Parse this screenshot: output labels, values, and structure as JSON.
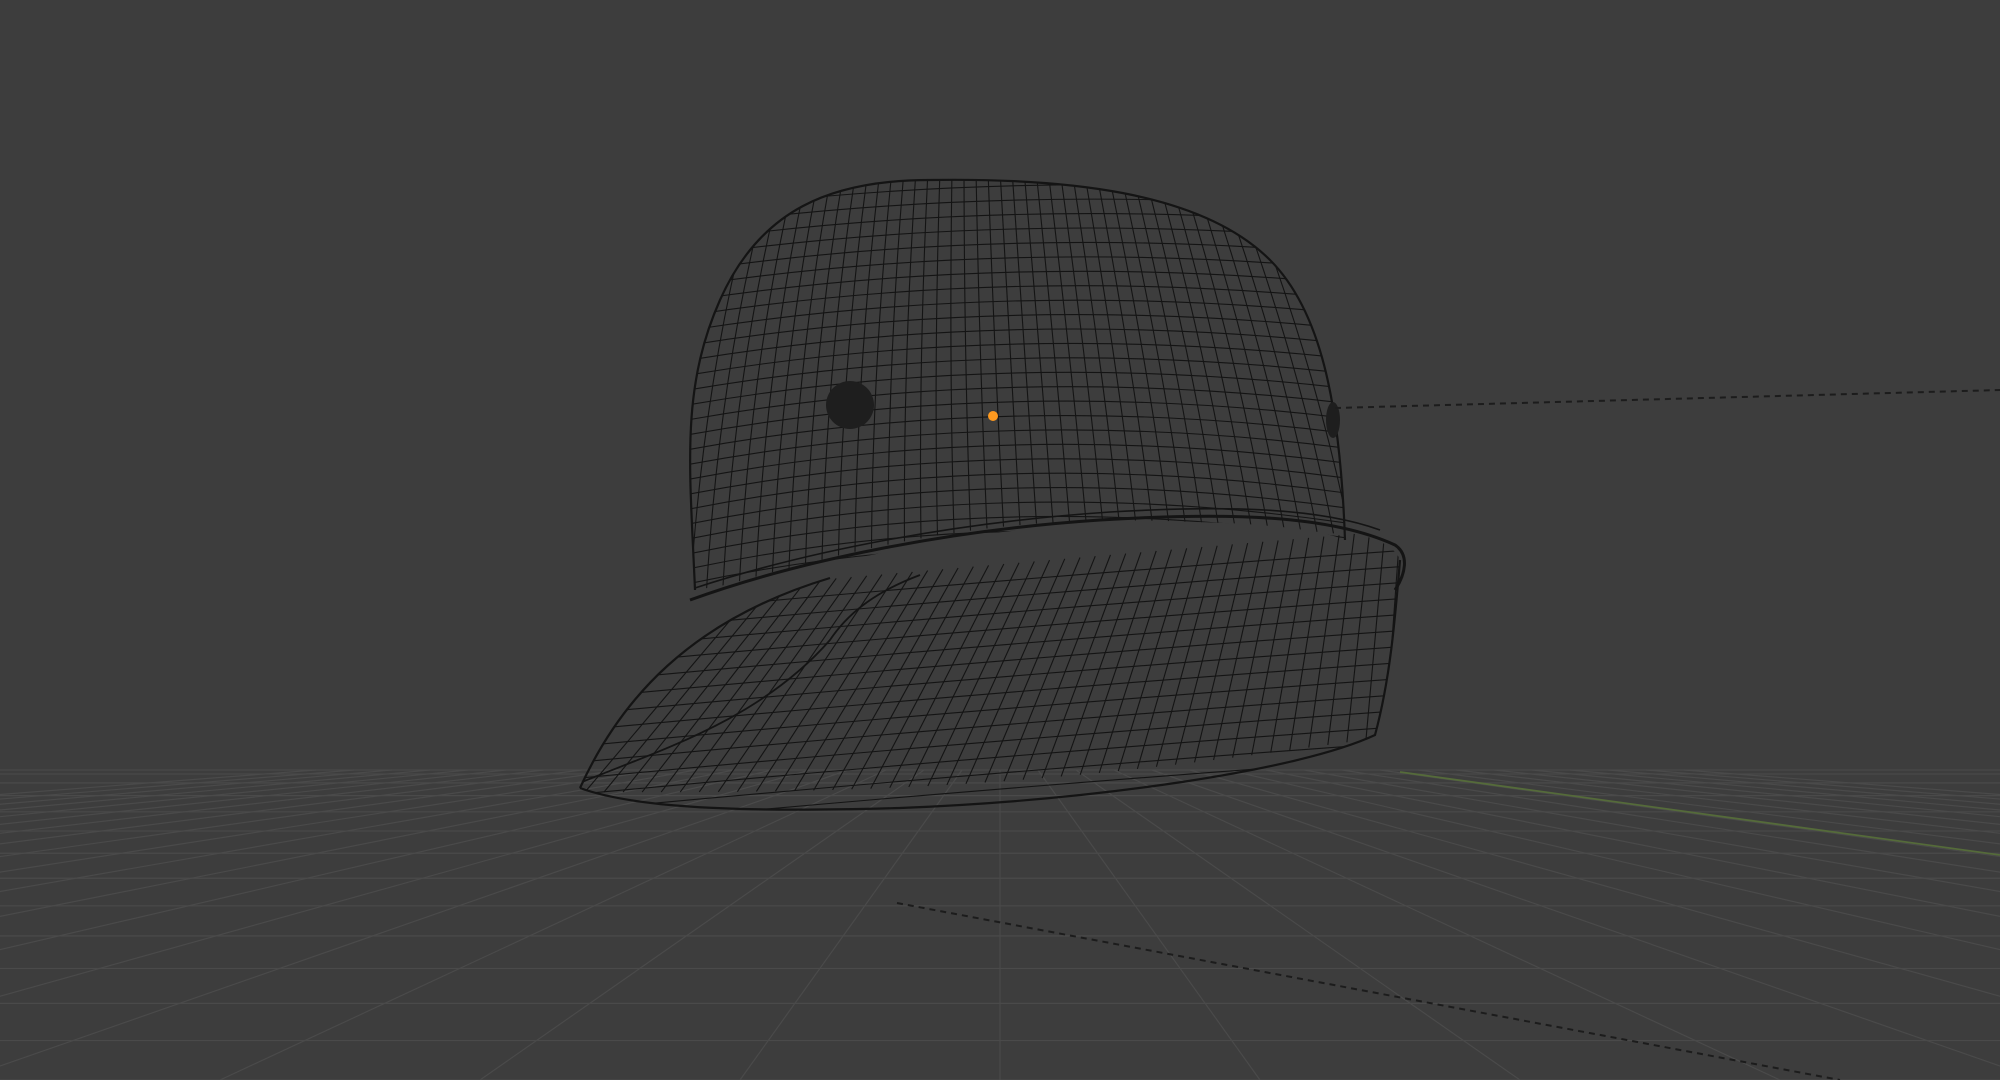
{
  "app": {
    "mode": "3d-viewport",
    "shading": "wireframe"
  },
  "scene": {
    "object": "helmet-mesh",
    "origin_selected": true
  },
  "colors": {
    "background": "#3d3d3d",
    "grid_line": "#4a4a4a",
    "wire": "#141414",
    "origin": "#ff9a1f",
    "y_axis": "#556b3a",
    "relation_line": "#1c1c1c"
  }
}
